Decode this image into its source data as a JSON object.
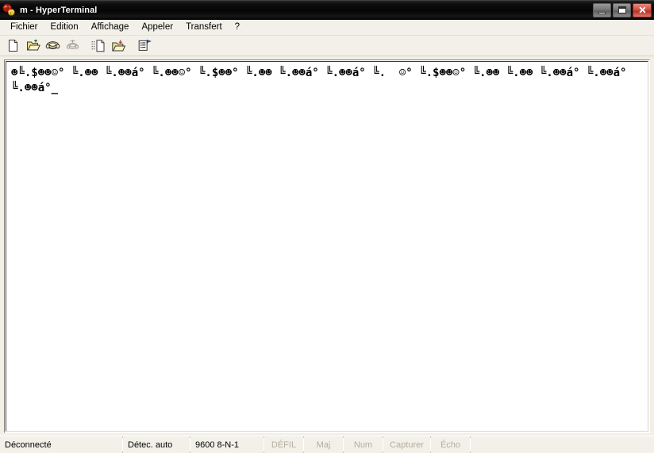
{
  "window": {
    "title": "m - HyperTerminal",
    "icon": "hyperterminal-globe-icon",
    "controls": {
      "minimize_label": "–",
      "maximize_label": "□",
      "close_label": "✕"
    },
    "accent_close_color": "#c0392b",
    "titlebar_color": "#000000"
  },
  "menubar": {
    "items": [
      {
        "label": "Fichier"
      },
      {
        "label": "Edition"
      },
      {
        "label": "Affichage"
      },
      {
        "label": "Appeler"
      },
      {
        "label": "Transfert"
      },
      {
        "label": "?"
      }
    ]
  },
  "toolbar": {
    "buttons": [
      {
        "name": "new-connection",
        "icon": "new-document-icon",
        "enabled": true
      },
      {
        "name": "open-connection",
        "icon": "open-folder-icon",
        "enabled": true
      },
      {
        "name": "call",
        "icon": "phone-icon",
        "enabled": true
      },
      {
        "name": "disconnect",
        "icon": "phone-hangup-icon",
        "enabled": false
      },
      {
        "name": "send-file",
        "icon": "send-file-icon",
        "enabled": true
      },
      {
        "name": "receive-file",
        "icon": "receive-file-icon",
        "enabled": true
      },
      {
        "name": "properties",
        "icon": "properties-icon",
        "enabled": true
      }
    ]
  },
  "terminal": {
    "text": "☻╚.$☻☻☺° ╚.☻☻ ╚.☻☻á° ╚.☻☻☺° ╚.$☻☻° ╚.☻☻ ╚.☻☻á° ╚.☻☻á° ╚.  ☺° ╚.$☻☻☺° ╚.☻☻ ╚.☻☻ ╚.☻☻á° ╚.☻☻á° ╚.☻☻á°",
    "cursor": "_",
    "background": "#ffffff",
    "foreground": "#000000"
  },
  "statusbar": {
    "connection_status": "Déconnecté",
    "detection": "Détec. auto",
    "line_settings": "9600 8-N-1",
    "indicators": [
      {
        "label": "DÉFIL",
        "active": false
      },
      {
        "label": "Maj",
        "active": false
      },
      {
        "label": "Num",
        "active": false
      },
      {
        "label": "Capturer",
        "active": false
      },
      {
        "label": "Écho",
        "active": false
      }
    ]
  }
}
